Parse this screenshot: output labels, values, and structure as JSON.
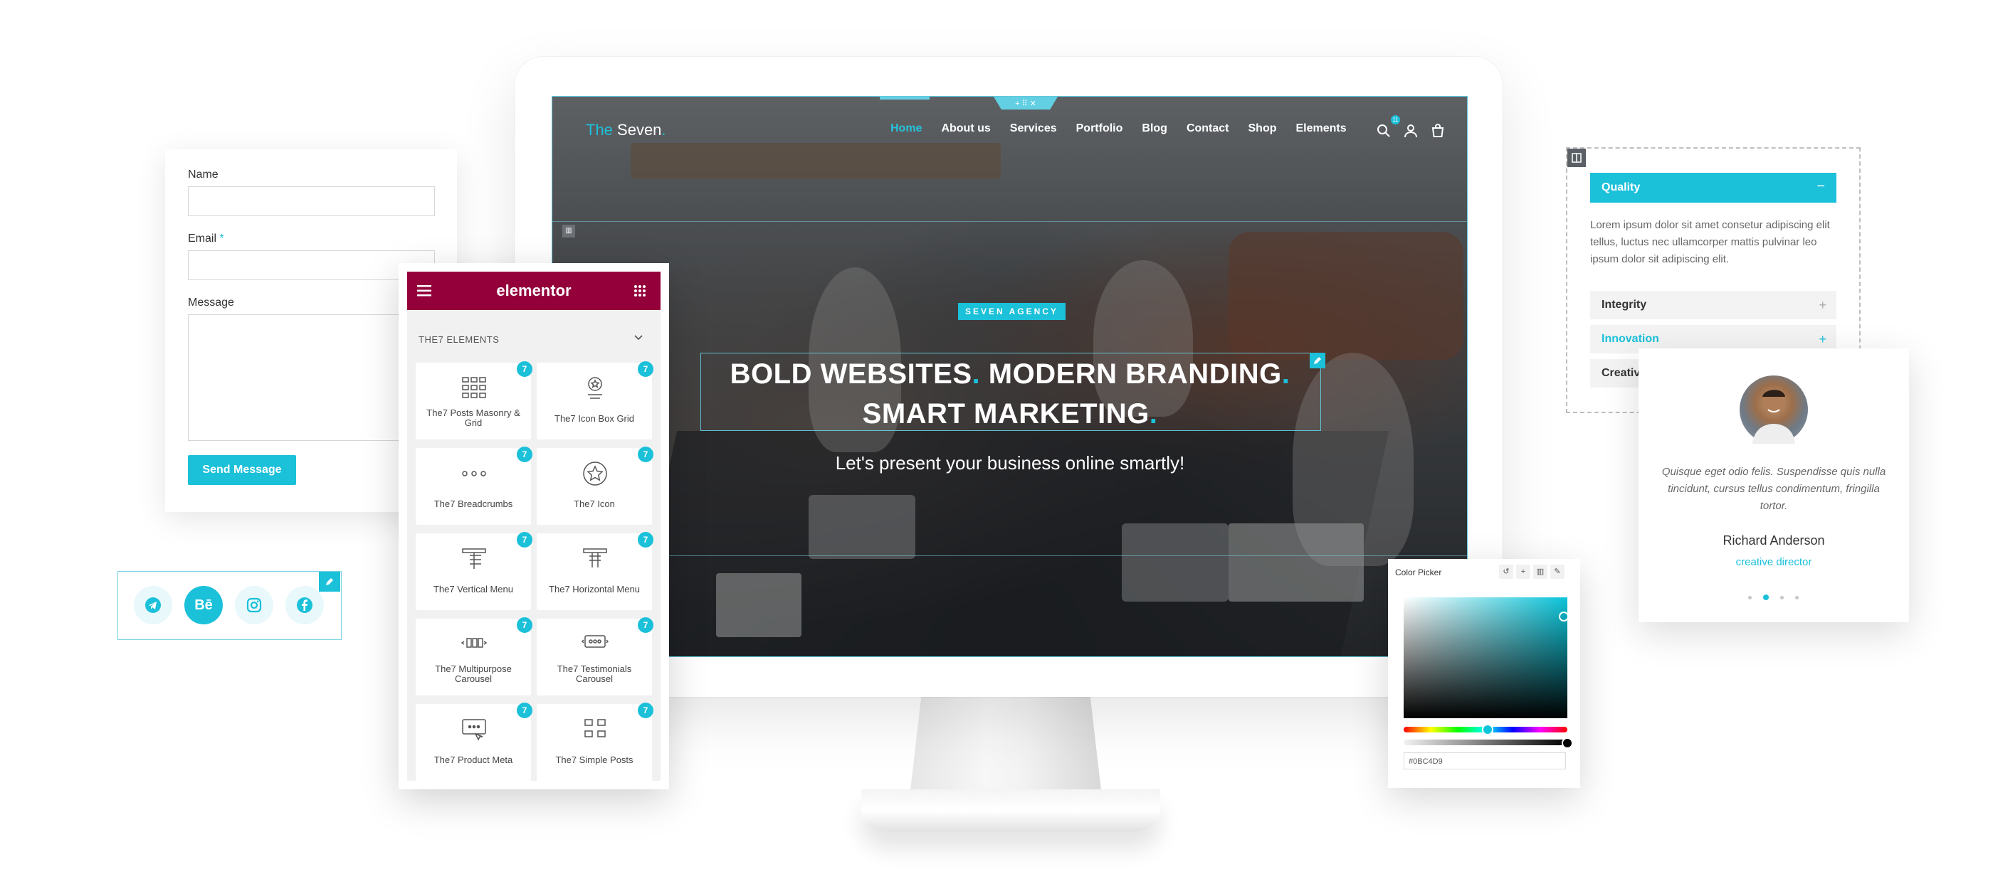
{
  "site": {
    "logo": {
      "prefix": "The",
      "name": " Seven",
      "dot": "."
    },
    "nav": [
      "Home",
      "About us",
      "Services",
      "Portfolio",
      "Blog",
      "Contact",
      "Shop",
      "Elements"
    ],
    "cart_count": "11",
    "handle_symbol": "+ ⠿ ✕",
    "hero": {
      "badge": "SEVEN AGENCY",
      "headline_line1_a": "BOLD WEBSITES",
      "headline_line1_b": " MODERN BRANDING",
      "headline_line2": "SMART MARKETING",
      "dot": ".",
      "subheadline": "Let's present your business online smartly!"
    }
  },
  "contact_form": {
    "name_label": "Name",
    "email_label": "Email",
    "required_mark": "*",
    "message_label": "Message",
    "submit_label": "Send Message"
  },
  "social": {
    "icons": [
      "telegram-icon",
      "behance-icon",
      "instagram-icon",
      "facebook-icon"
    ],
    "behance_text": "Bē"
  },
  "elementor": {
    "title": "elementor",
    "section": "THE7 ELEMENTS",
    "badge": "7",
    "widgets": [
      {
        "label": "The7 Posts Masonry & Grid",
        "icon": "grid-icon"
      },
      {
        "label": "The7 Icon Box Grid",
        "icon": "icon-box-icon"
      },
      {
        "label": "The7 Breadcrumbs",
        "icon": "breadcrumbs-icon"
      },
      {
        "label": "The7 Icon",
        "icon": "star-icon"
      },
      {
        "label": "The7 Vertical Menu",
        "icon": "vertical-menu-icon"
      },
      {
        "label": "The7 Horizontal Menu",
        "icon": "horizontal-menu-icon"
      },
      {
        "label": "The7 Multipurpose Carousel",
        "icon": "carousel-icon"
      },
      {
        "label": "The7 Testimonials Carousel",
        "icon": "testimonials-icon"
      },
      {
        "label": "The7 Product Meta",
        "icon": "product-meta-icon"
      },
      {
        "label": "The7 Simple Posts",
        "icon": "simple-posts-icon"
      }
    ]
  },
  "accordion": {
    "active_title": "Quality",
    "active_toggle": "−",
    "body": "Lorem ipsum dolor sit amet consetur adipiscing elit tellus, luctus nec ullamcorper mattis pulvinar leo ipsum dolor sit adipiscing elit.",
    "items": [
      {
        "title": "Integrity",
        "accent": false
      },
      {
        "title": "Innovation",
        "accent": true
      },
      {
        "title": "Creativi",
        "accent": false
      }
    ],
    "plus": "+"
  },
  "testimonial": {
    "quote": "Quisque eget odio felis. Suspendisse quis nulla tincidunt, cursus tellus condimentum, fringilla tortor.",
    "name": "Richard Anderson",
    "role": "creative director",
    "active_slide": 2,
    "slide_count": 4
  },
  "color_picker": {
    "title": "Color Picker",
    "tools": [
      "↺",
      "+",
      "▥",
      "✎"
    ],
    "hex": "#0BC4D9"
  },
  "colors": {
    "accent": "#1bc0d9",
    "elementor": "#93003a"
  }
}
